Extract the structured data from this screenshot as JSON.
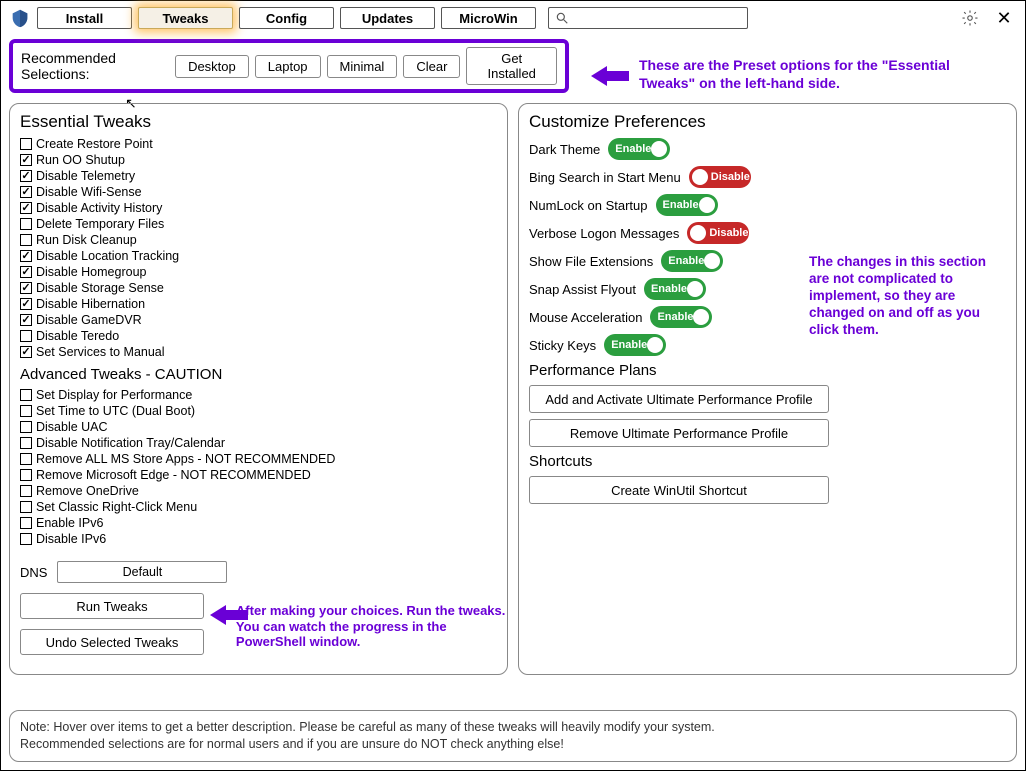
{
  "nav": {
    "install": "Install",
    "tweaks": "Tweaks",
    "config": "Config",
    "updates": "Updates",
    "microwin": "MicroWin"
  },
  "search_placeholder": "",
  "preset": {
    "label": "Recommended Selections:",
    "desktop": "Desktop",
    "laptop": "Laptop",
    "minimal": "Minimal",
    "clear": "Clear",
    "get_installed": "Get Installed",
    "annotation": "These are the Preset options for the \"Essential Tweaks\" on the left-hand side."
  },
  "left": {
    "essential_title": "Essential Tweaks",
    "essential": [
      {
        "label": "Create Restore Point",
        "checked": false
      },
      {
        "label": "Run OO Shutup",
        "checked": true
      },
      {
        "label": "Disable Telemetry",
        "checked": true
      },
      {
        "label": "Disable Wifi-Sense",
        "checked": true
      },
      {
        "label": "Disable Activity History",
        "checked": true
      },
      {
        "label": "Delete Temporary Files",
        "checked": false
      },
      {
        "label": "Run Disk Cleanup",
        "checked": false
      },
      {
        "label": "Disable Location Tracking",
        "checked": true
      },
      {
        "label": "Disable Homegroup",
        "checked": true
      },
      {
        "label": "Disable Storage Sense",
        "checked": true
      },
      {
        "label": "Disable Hibernation",
        "checked": true
      },
      {
        "label": "Disable GameDVR",
        "checked": true
      },
      {
        "label": "Disable Teredo",
        "checked": false
      },
      {
        "label": "Set Services to Manual",
        "checked": true
      }
    ],
    "advanced_title": "Advanced Tweaks - CAUTION",
    "advanced": [
      {
        "label": "Set Display for Performance",
        "checked": false
      },
      {
        "label": "Set Time to UTC (Dual Boot)",
        "checked": false
      },
      {
        "label": "Disable UAC",
        "checked": false
      },
      {
        "label": "Disable Notification Tray/Calendar",
        "checked": false
      },
      {
        "label": "Remove ALL MS Store Apps - NOT RECOMMENDED",
        "checked": false
      },
      {
        "label": "Remove Microsoft Edge - NOT RECOMMENDED",
        "checked": false
      },
      {
        "label": "Remove OneDrive",
        "checked": false
      },
      {
        "label": "Set Classic Right-Click Menu",
        "checked": false
      },
      {
        "label": "Enable IPv6",
        "checked": false
      },
      {
        "label": "Disable IPv6",
        "checked": false
      }
    ],
    "dns_label": "DNS",
    "dns_value": "Default",
    "run_tweaks": "Run Tweaks",
    "undo_tweaks": "Undo Selected Tweaks",
    "annotation": "After making your choices. Run the tweaks. You can watch the progress in the PowerShell window."
  },
  "right": {
    "customize_title": "Customize Preferences",
    "toggles": [
      {
        "label": "Dark Theme",
        "state": "Enable"
      },
      {
        "label": "Bing Search in Start Menu",
        "state": "Disable"
      },
      {
        "label": "NumLock on Startup",
        "state": "Enable"
      },
      {
        "label": "Verbose Logon Messages",
        "state": "Disable"
      },
      {
        "label": "Show File Extensions",
        "state": "Enable"
      },
      {
        "label": "Snap Assist Flyout",
        "state": "Enable"
      },
      {
        "label": "Mouse Acceleration",
        "state": "Enable"
      },
      {
        "label": "Sticky Keys",
        "state": "Enable"
      }
    ],
    "annotation": "The changes in this section are not complicated to implement, so they are changed on and off as you click them.",
    "perf_title": "Performance Plans",
    "perf_add": "Add and Activate Ultimate Performance Profile",
    "perf_remove": "Remove Ultimate Performance Profile",
    "shortcuts_title": "Shortcuts",
    "shortcut_create": "Create WinUtil Shortcut"
  },
  "footer": {
    "line1": "Note: Hover over items to get a better description. Please be careful as many of these tweaks will heavily modify your system.",
    "line2": "Recommended selections are for normal users and if you are unsure do NOT check anything else!"
  }
}
